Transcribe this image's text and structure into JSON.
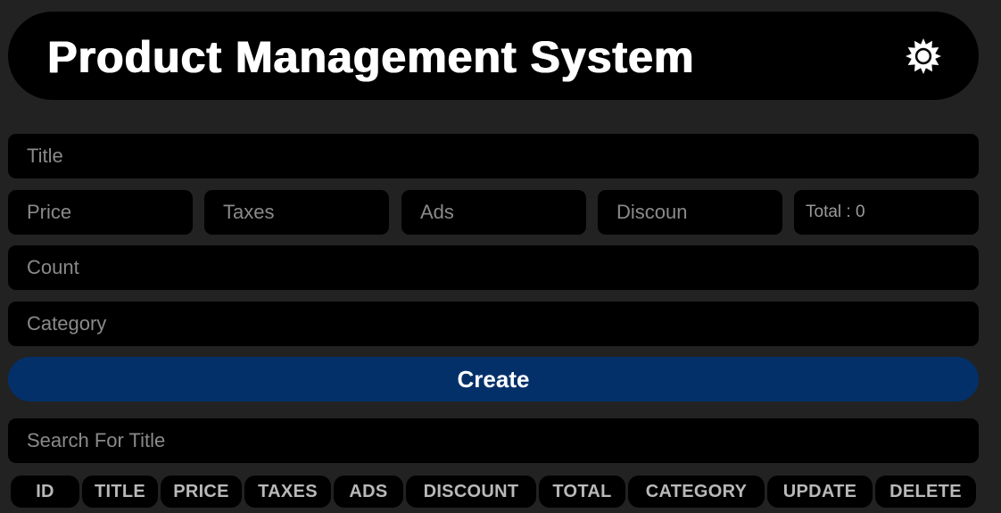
{
  "header": {
    "title": "Product Management System",
    "theme_icon": "sun-icon"
  },
  "form": {
    "title_placeholder": "Title",
    "price_placeholder": "Price",
    "taxes_placeholder": "Taxes",
    "ads_placeholder": "Ads",
    "discount_placeholder": "Discoun",
    "total_text": "Total : 0",
    "count_placeholder": "Count",
    "category_placeholder": "Category",
    "create_label": "Create"
  },
  "search": {
    "placeholder": "Search For Title"
  },
  "table": {
    "headers": [
      "ID",
      "TITLE",
      "PRICE",
      "TAXES",
      "ADS",
      "DISCOUNT",
      "TOTAL",
      "CATEGORY",
      "UPDATE",
      "DELETE"
    ]
  },
  "colors": {
    "page_background": "#222222",
    "surface": "#000000",
    "accent": "#04306a",
    "placeholder_text": "#8a8a8a",
    "header_cell_text": "#b9b9b9"
  }
}
